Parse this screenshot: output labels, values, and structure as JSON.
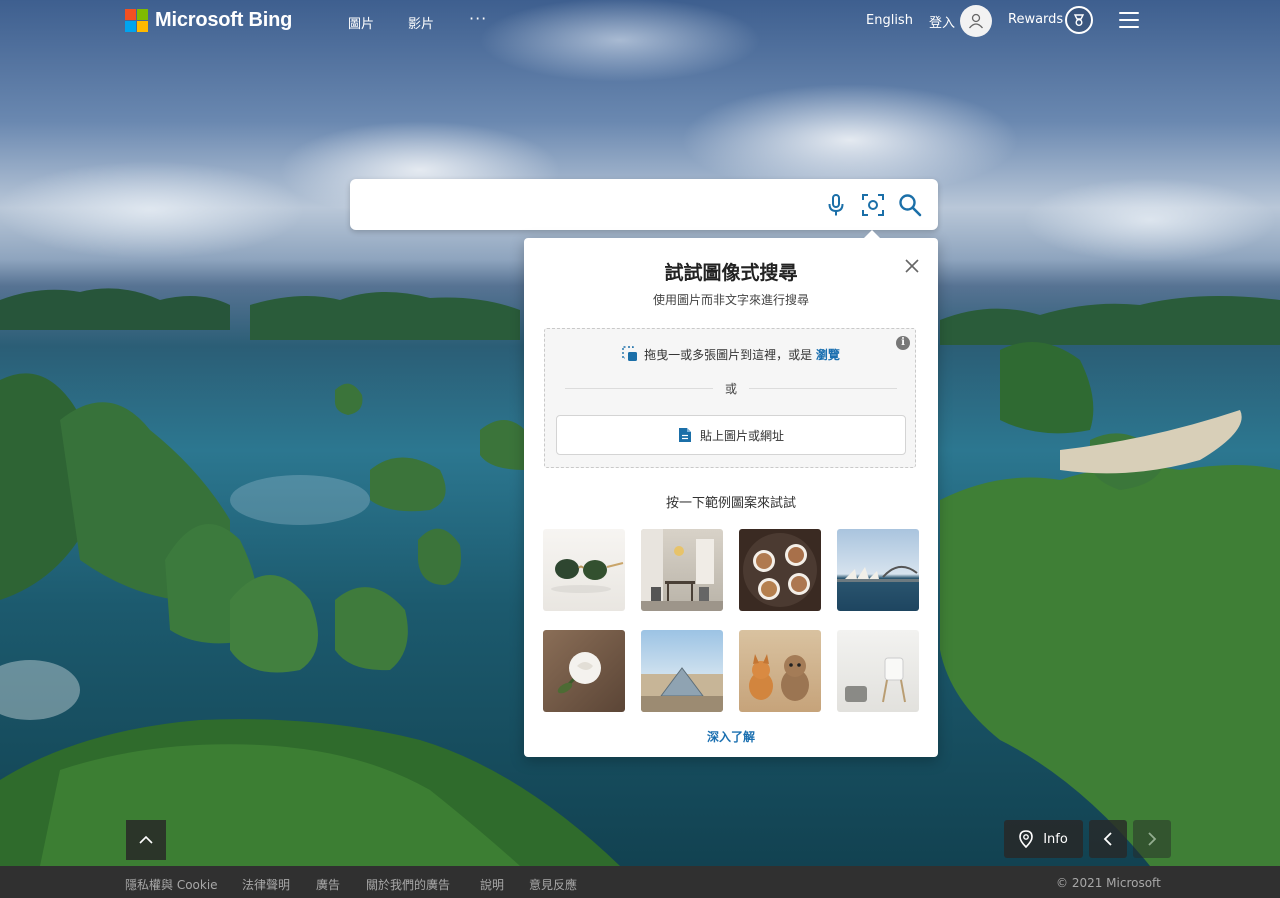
{
  "brand": {
    "name": "Microsoft Bing",
    "colors": [
      "#f25022",
      "#7fba00",
      "#00a4ef",
      "#ffb900"
    ]
  },
  "nav": {
    "images": "圖片",
    "videos": "影片",
    "more": "···"
  },
  "header": {
    "language": "English",
    "signin": "登入",
    "rewards": "Rewards"
  },
  "search": {
    "value": "",
    "placeholder": ""
  },
  "visual_search": {
    "title": "試試圖像式搜尋",
    "subtitle": "使用圖片而非文字來進行搜尋",
    "drag_text": "拖曳一或多張圖片到這裡，或是",
    "browse": "瀏覽",
    "or": "或",
    "paste": "貼上圖片或網址",
    "examples_label": "按一下範例圖案來試試",
    "learn_more": "深入了解",
    "info_icon": "i"
  },
  "controls": {
    "info": "Info"
  },
  "footer": {
    "links": [
      "隱私權與 Cookie",
      "法律聲明",
      "廣告",
      "關於我們的廣告",
      "說明",
      "意見反應"
    ],
    "copyright": "© 2021 Microsoft"
  },
  "accent": "#1a6fb0"
}
